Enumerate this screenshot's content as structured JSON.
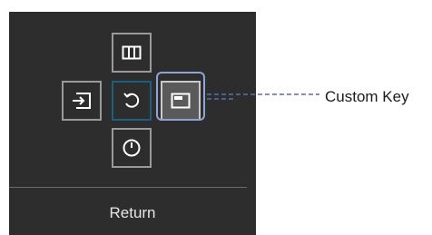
{
  "menu": {
    "return_label": "Return"
  },
  "callout": {
    "label": "Custom Key"
  },
  "icons": {
    "top": "picture-mode-icon",
    "left": "source-input-icon",
    "center": "return-icon",
    "right": "custom-key-icon",
    "bottom": "power-icon"
  },
  "colors": {
    "panel": "#2d2d2d",
    "button_border": "#9a9a9a",
    "center_border": "#1d5d86",
    "selected_fill": "#5a5a5a",
    "focus_ring": "#8fa4d6",
    "connector": "#5a6fb0"
  }
}
